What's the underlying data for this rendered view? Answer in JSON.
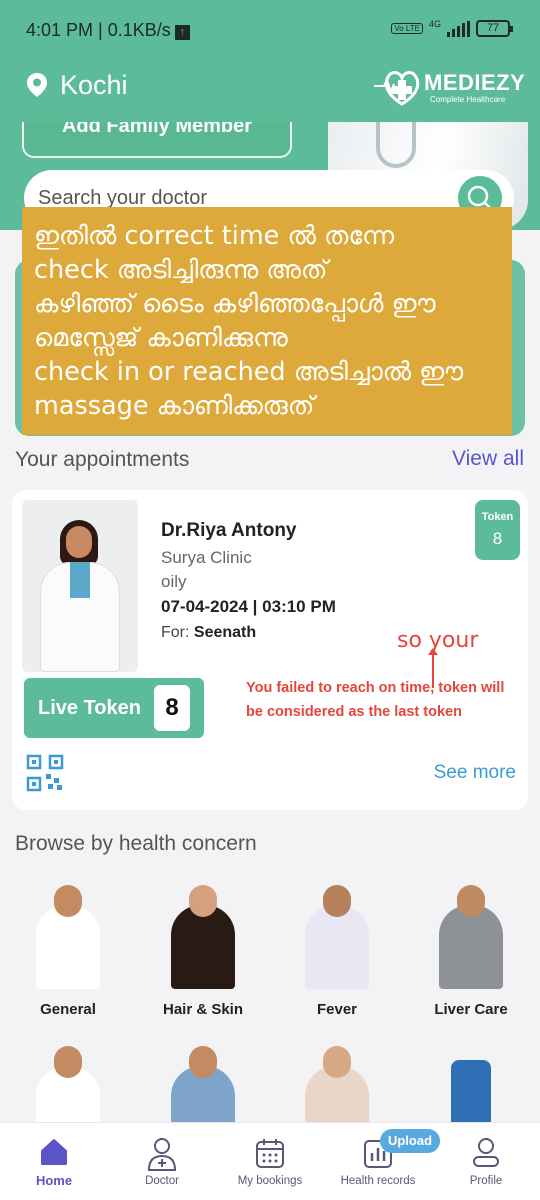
{
  "status_bar": {
    "time": "4:01 PM | 0.1KB/s",
    "network": "4G",
    "volte": "Vo LTE",
    "battery": "77"
  },
  "app_bar": {
    "location": "Kochi",
    "logo_name": "MEDIEZY",
    "logo_tagline": "Complete Healthcare"
  },
  "banner": {
    "family_button": "Add Family Member"
  },
  "search": {
    "placeholder": "Search your doctor"
  },
  "overlay_note": {
    "lines": [
      "ഇതിൽ correct time ൽ തന്നേ",
      "check അടിച്ചിരുന്നു അത്",
      "കഴിഞ്ഞ് ടൈം കഴിഞ്ഞപ്പോൾ ഈ",
      " മെസ്സേജ് കാണിക്കുന്നു",
      "check in or reached അടിച്ചാൽ ഈ",
      " massage കാണിക്കരുത്"
    ],
    "color": "#dea93b"
  },
  "appointments": {
    "title": "Your appointments",
    "view_all": "View all",
    "card": {
      "doctor": "Dr.Riya Antony",
      "clinic": "Surya Clinic",
      "condition": "oily",
      "datetime": "07-04-2024 | 03:10 PM",
      "for_label": "For:",
      "for_name": "Seenath",
      "token_label": "Token",
      "token_number": "8",
      "live_token_label": "Live Token",
      "live_token_number": "8",
      "see_more": "See more",
      "annotation": "so your",
      "warning": "You failed to reach on time, token will be considered as the last token"
    }
  },
  "concerns": {
    "title": "Browse by health concern",
    "items": [
      {
        "label": "General",
        "bg": "#3fc27a"
      },
      {
        "label": "Hair & Skin",
        "bg": "#dc6ca8"
      },
      {
        "label": "Fever",
        "bg": "#10b35a"
      },
      {
        "label": "Liver Care",
        "bg": "#f2e15a"
      },
      {
        "label": "",
        "bg": "#6aa834"
      },
      {
        "label": "",
        "bg": "#f08436"
      },
      {
        "label": "",
        "bg": "#6e5fc9"
      },
      {
        "label": "",
        "bg": "#4aa8c7"
      }
    ]
  },
  "bottom_nav": {
    "items": [
      {
        "label": "Home",
        "icon": "home-icon"
      },
      {
        "label": "Doctor",
        "icon": "doctor-icon"
      },
      {
        "label": "My bookings",
        "icon": "calendar-icon"
      },
      {
        "label": "Health records",
        "icon": "chart-icon"
      },
      {
        "label": "Profile",
        "icon": "profile-icon"
      }
    ],
    "upload_badge": "Upload",
    "active": "Home"
  },
  "colors": {
    "brand_green": "#5cbb98",
    "accent_purple": "#5b55c7",
    "link_blue": "#3a9bd2",
    "warning_red": "#e3463b"
  }
}
